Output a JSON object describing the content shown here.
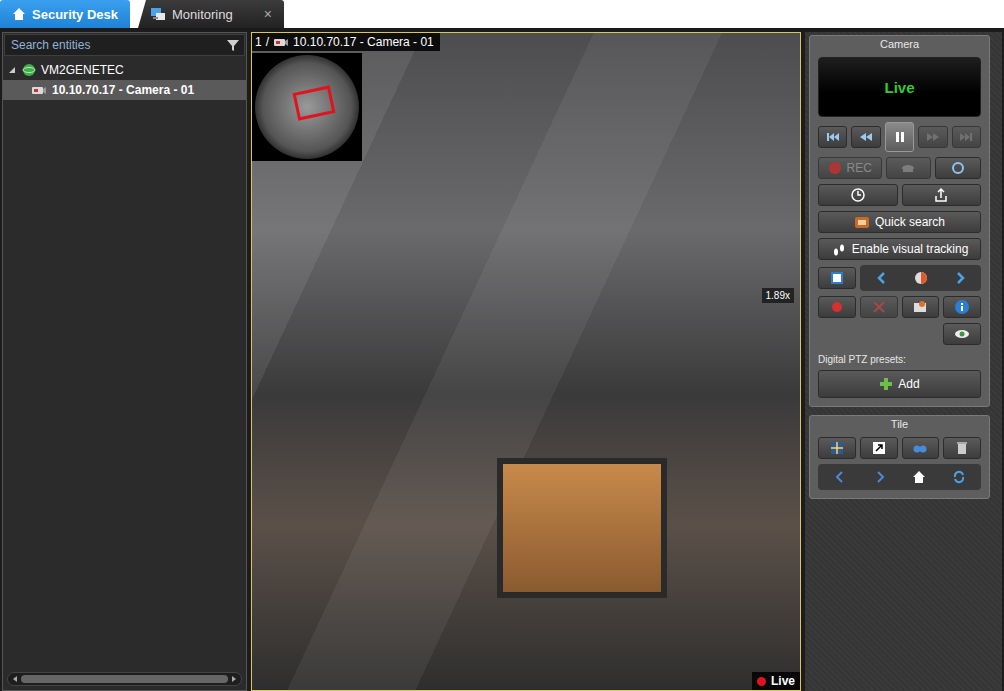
{
  "tabs": [
    {
      "label": "Security Desk",
      "selected": true,
      "closable": false
    },
    {
      "label": "Monitoring",
      "selected": false,
      "closable": true
    }
  ],
  "tab_close": "×",
  "search": {
    "placeholder": "Search entities"
  },
  "tree": {
    "label": "VM2GENETEC",
    "expanded": true,
    "selected": false,
    "children": [
      {
        "label": "10.10.70.17 - Camera - 01",
        "selected": true
      }
    ]
  },
  "tile": {
    "number": "1",
    "separator": "/",
    "camera": "10.10.70.17 - Camera - 01",
    "zoom": "1.89x",
    "live": "Live",
    "selected": true
  },
  "camera_panel": {
    "title": "Camera",
    "status": "Live",
    "playback": [
      {
        "kind": "start",
        "disabled": false,
        "selected": false
      },
      {
        "kind": "rewind",
        "disabled": false,
        "selected": false
      },
      {
        "kind": "pause",
        "disabled": false,
        "selected": true
      },
      {
        "kind": "forward",
        "disabled": true,
        "selected": false
      },
      {
        "kind": "end",
        "disabled": true,
        "selected": false
      }
    ],
    "rec": {
      "label": "REC",
      "disabled": true
    },
    "quick_search": "Quick search",
    "visual_tracking": "Enable visual tracking",
    "presets_label": "Digital PTZ presets:",
    "add": "Add"
  },
  "tile_panel": {
    "title": "Tile"
  }
}
